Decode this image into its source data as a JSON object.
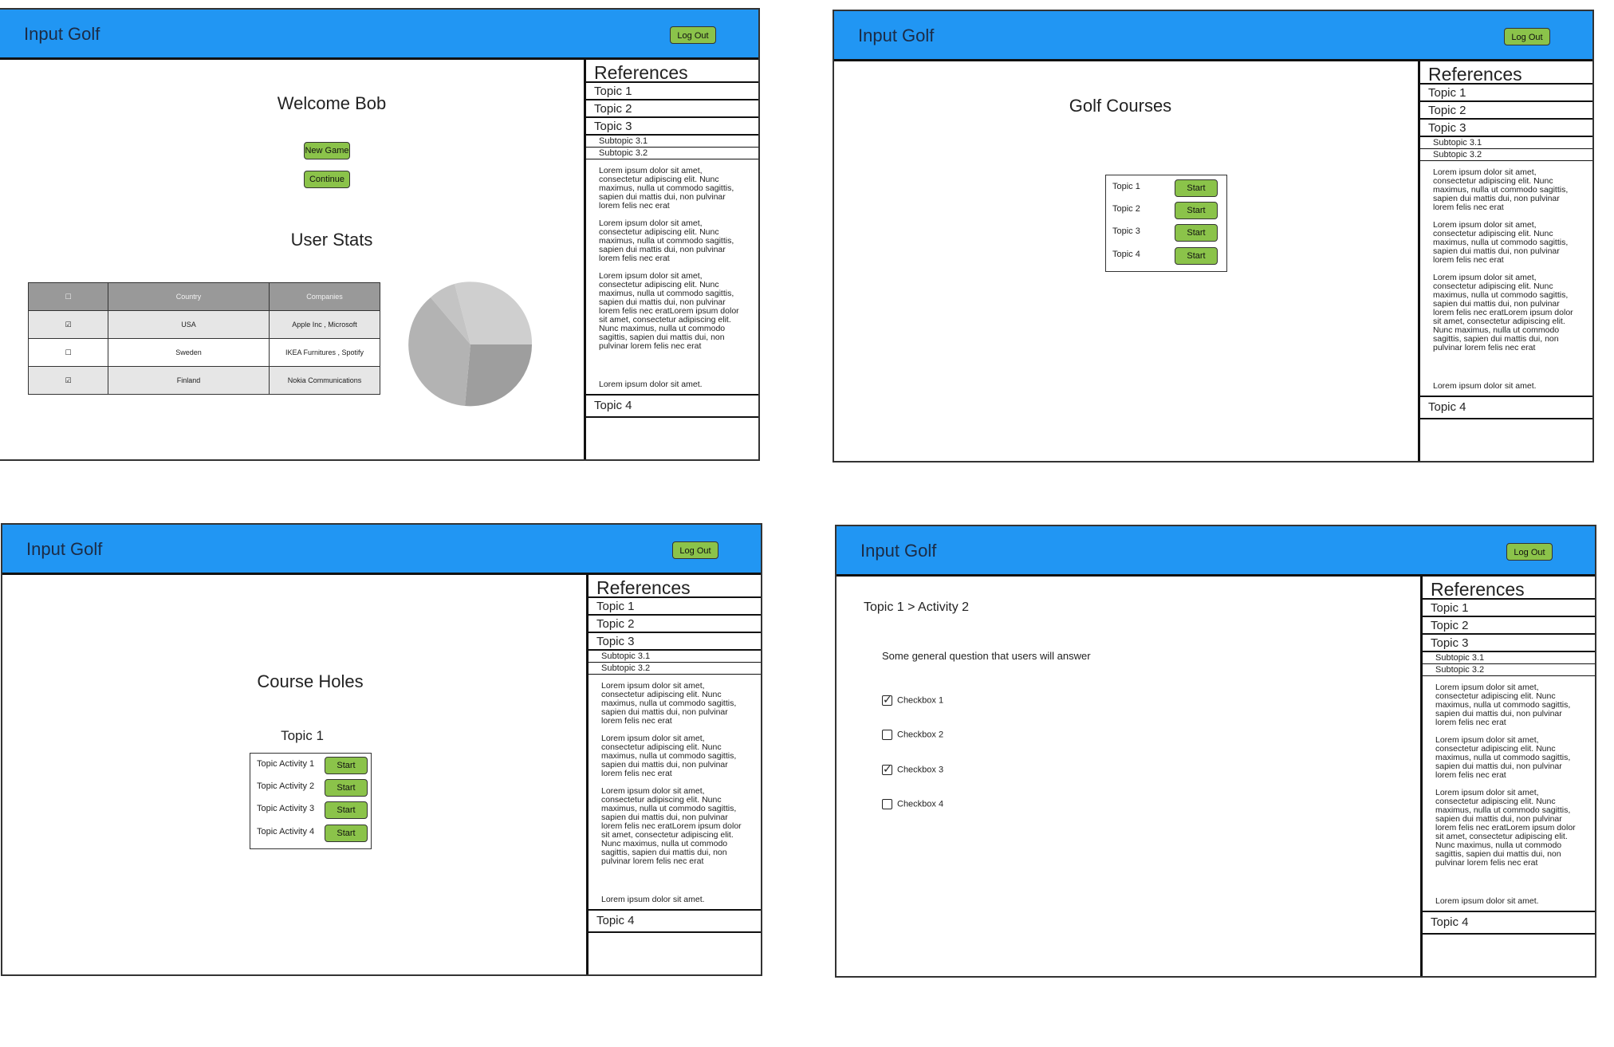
{
  "app": {
    "title": "Input Golf",
    "logout_label": "Log Out"
  },
  "references": {
    "title": "References",
    "topics": [
      "Topic 1",
      "Topic 2",
      "Topic 3"
    ],
    "subtopics": [
      "Subtopic 3.1",
      "Subtopic 3.2"
    ],
    "paragraphs": [
      "Lorem ipsum dolor sit amet, consectetur adipiscing elit. Nunc maximus, nulla ut commodo sagittis, sapien dui mattis dui, non pulvinar lorem felis nec erat",
      "Lorem ipsum dolor sit amet, consectetur adipiscing elit. Nunc maximus, nulla ut commodo sagittis, sapien dui mattis dui, non pulvinar lorem felis nec erat",
      "Lorem ipsum dolor sit amet, consectetur adipiscing elit. Nunc maximus, nulla ut commodo sagittis, sapien dui mattis dui, non pulvinar lorem felis nec eratLorem ipsum dolor sit amet, consectetur adipiscing elit. Nunc maximus, nulla ut commodo sagittis, sapien dui mattis dui, non pulvinar lorem felis nec erat"
    ],
    "tail": "Lorem ipsum dolor sit amet.",
    "topic4": "Topic 4"
  },
  "screen1": {
    "welcome": "Welcome Bob",
    "new_game": "New Game",
    "continue": "Continue",
    "stats_title": "User Stats",
    "table": {
      "headers": [
        "☐",
        "Country",
        "Companies"
      ],
      "rows": [
        {
          "check": "☑",
          "country": "USA",
          "companies": "Apple Inc , Microsoft"
        },
        {
          "check": "☐",
          "country": "Sweden",
          "companies": "IKEA Furnitures , Spotify"
        },
        {
          "check": "☑",
          "country": "Finland",
          "companies": "Nokia Communications"
        }
      ]
    }
  },
  "screen2": {
    "title": "Golf Courses",
    "rows": [
      {
        "label": "Topic 1",
        "button": "Start"
      },
      {
        "label": "Topic 2",
        "button": "Start"
      },
      {
        "label": "Topic 3",
        "button": "Start"
      },
      {
        "label": "Topic 4",
        "button": "Start"
      }
    ]
  },
  "screen3": {
    "title": "Course Holes",
    "subtitle": "Topic 1",
    "rows": [
      {
        "label": "Topic Activity 1",
        "button": "Start"
      },
      {
        "label": "Topic Activity  2",
        "button": "Start"
      },
      {
        "label": "Topic Activity  3",
        "button": "Start"
      },
      {
        "label": "Topic Activity  4",
        "button": "Start"
      }
    ]
  },
  "screen4": {
    "breadcrumb": "Topic 1 > Activity 2",
    "question": "Some general question that users will answer",
    "checkboxes": [
      {
        "label": "Checkbox 1",
        "checked": true
      },
      {
        "label": "Checkbox 2",
        "checked": false
      },
      {
        "label": "Checkbox 3",
        "checked": true
      },
      {
        "label": "Checkbox 4",
        "checked": false
      }
    ]
  },
  "colors": {
    "header": "#2196f3",
    "button": "#8bc34a",
    "table_header": "#999999"
  }
}
